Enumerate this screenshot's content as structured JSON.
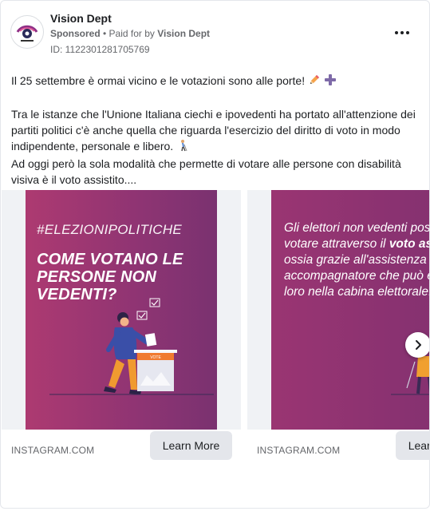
{
  "advertiser": {
    "name": "Vision Dept",
    "sponsored_label": "Sponsored",
    "paid_for_prefix": " • Paid for by ",
    "paid_for_name": "Vision Dept",
    "ad_id": "ID: 1122301281705769",
    "avatar_icon": "eye-logo-icon",
    "more_icon": "more-options-icon"
  },
  "post": {
    "line1": "Il 25 settembre è ormai vicino e le votazioni sono alle porte! ",
    "paragraph2": "Tra le istanze che l'Unione Italiana ciechi e ipovedenti ha portato all'attenzione dei partiti politici c'è anche quella che riguarda l'esercizio del diritto di voto in modo indipendente, personale e libero. ",
    "paragraph3": "Ad oggi però la sola modalità che permette di votare alle persone con disabilità visiva è il voto assistito....",
    "emojis": [
      "pencil",
      "plus",
      "person-with-cane"
    ]
  },
  "carousel": {
    "cards": [
      {
        "hashtag": "#ELEZIONIPOLITICHE",
        "headline": "COME VOTANO LE PERSONE NON VEDENTI?",
        "ballot_label": "VOTE",
        "domain": "INSTAGRAM.COM",
        "cta": "Learn More"
      },
      {
        "text_before": "Gli elettori non vedenti possono votare attraverso il ",
        "text_bold": "voto assistito",
        "text_after": ", ossia grazie all'assistenza di un accompagnatore che può entrare con loro nella cabina elettorale.",
        "domain": "INSTAGRAM.COM",
        "cta": "Learn More"
      }
    ],
    "next_icon": "chevron-right-icon"
  },
  "colors": {
    "card_gradient_start": "#ad3a71",
    "card_gradient_end": "#7a3270",
    "text_primary": "#1c1e21",
    "text_secondary": "#65676b",
    "button_bg": "#e4e6eb"
  }
}
